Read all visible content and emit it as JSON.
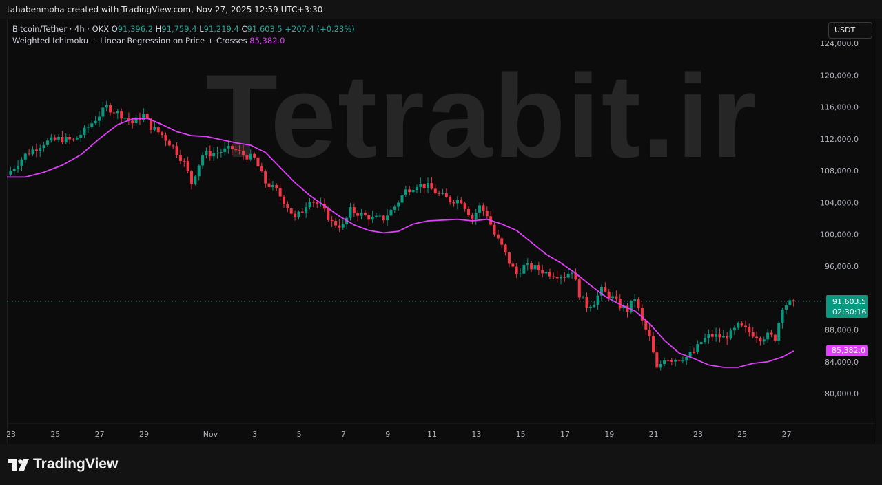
{
  "header": {
    "credit": "tahabenmoha created with TradingView.com, Nov 27, 2025 12:59 UTC+3:30"
  },
  "legend": {
    "symbol": "Bitcoin/Tether · 4h · OKX",
    "o_label": "O",
    "o_value": "91,396.2",
    "h_label": "H",
    "h_value": "91,759.4",
    "l_label": "L",
    "l_value": "91,219.4",
    "c_label": "C",
    "c_value": "91,603.5",
    "change": "+207.4 (+0.23%)",
    "indicator_name": "Weighted Ichimoku + Linear Regression on Price + Crosses",
    "indicator_value": "85,382.0"
  },
  "currency_button": "USDT",
  "watermark": "Tetrabit.ir",
  "price_tag": {
    "price": "91,603.5",
    "countdown": "02:30:16"
  },
  "ma_tag": "85,382.0",
  "footer": {
    "brand": "TradingView"
  },
  "colors": {
    "up": "#089981",
    "down": "#f23645",
    "ma": "#e040fb",
    "background": "#0c0c0c"
  },
  "chart_data": {
    "type": "candlestick",
    "interval": "4h",
    "ylim": [
      78000,
      126000
    ],
    "y_ticks": [
      80000,
      84000,
      88000,
      92000,
      96000,
      100000,
      104000,
      108000,
      112000,
      116000,
      120000,
      124000
    ],
    "y_tick_labels": [
      "80,000.0",
      "84,000.0",
      "88,000.0",
      "",
      "96,000.0",
      "100,000.0",
      "104,000.0",
      "108,000.0",
      "112,000.0",
      "116,000.0",
      "120,000.0",
      "124,000.0"
    ],
    "x_ticks": [
      {
        "label": "23",
        "slot": 0
      },
      {
        "label": "25",
        "slot": 12
      },
      {
        "label": "27",
        "slot": 24
      },
      {
        "label": "29",
        "slot": 36
      },
      {
        "label": "Nov",
        "slot": 54
      },
      {
        "label": "3",
        "slot": 66
      },
      {
        "label": "5",
        "slot": 78
      },
      {
        "label": "7",
        "slot": 90
      },
      {
        "label": "9",
        "slot": 102
      },
      {
        "label": "11",
        "slot": 114
      },
      {
        "label": "13",
        "slot": 126
      },
      {
        "label": "15",
        "slot": 138
      },
      {
        "label": "17",
        "slot": 150
      },
      {
        "label": "19",
        "slot": 162
      },
      {
        "label": "21",
        "slot": 174
      },
      {
        "label": "23",
        "slot": 186
      },
      {
        "label": "25",
        "slot": 198
      },
      {
        "label": "27",
        "slot": 210
      }
    ],
    "close_path": [
      [
        0,
        107500
      ],
      [
        5,
        110000
      ],
      [
        10,
        111500
      ],
      [
        14,
        112000
      ],
      [
        18,
        111800
      ],
      [
        21,
        113000
      ],
      [
        24,
        114500
      ],
      [
        27,
        116000
      ],
      [
        31,
        115000
      ],
      [
        34,
        114000
      ],
      [
        37,
        115000
      ],
      [
        39,
        113500
      ],
      [
        42,
        112500
      ],
      [
        45,
        111000
      ],
      [
        48,
        109000
      ],
      [
        50,
        106500
      ],
      [
        53,
        110000
      ],
      [
        57,
        110300
      ],
      [
        61,
        110800
      ],
      [
        64,
        110000
      ],
      [
        67,
        109500
      ],
      [
        70,
        106500
      ],
      [
        73,
        105500
      ],
      [
        76,
        103500
      ],
      [
        78,
        102000
      ],
      [
        80,
        103000
      ],
      [
        82,
        104500
      ],
      [
        85,
        103500
      ],
      [
        88,
        101500
      ],
      [
        91,
        101000
      ],
      [
        93,
        103000
      ],
      [
        96,
        102500
      ],
      [
        99,
        102000
      ],
      [
        102,
        102000
      ],
      [
        105,
        103500
      ],
      [
        108,
        105500
      ],
      [
        111,
        106300
      ],
      [
        114,
        106000
      ],
      [
        117,
        105000
      ],
      [
        120,
        104300
      ],
      [
        123,
        104300
      ],
      [
        124,
        103500
      ],
      [
        126,
        102000
      ],
      [
        128,
        103500
      ],
      [
        130,
        102500
      ],
      [
        132,
        100000
      ],
      [
        134,
        98500
      ],
      [
        136,
        96500
      ],
      [
        138,
        95000
      ],
      [
        140,
        96000
      ],
      [
        143,
        95800
      ],
      [
        146,
        95200
      ],
      [
        148,
        95000
      ],
      [
        151,
        94800
      ],
      [
        153,
        95500
      ],
      [
        155,
        92500
      ],
      [
        157,
        91000
      ],
      [
        159,
        91500
      ],
      [
        161,
        93000
      ],
      [
        164,
        92000
      ],
      [
        166,
        91000
      ],
      [
        168,
        90500
      ],
      [
        170,
        92000
      ],
      [
        172,
        89000
      ],
      [
        174,
        87000
      ],
      [
        176,
        83000
      ],
      [
        178,
        84500
      ],
      [
        180,
        84300
      ],
      [
        182,
        84400
      ],
      [
        184,
        84600
      ],
      [
        186,
        85200
      ],
      [
        188,
        86500
      ],
      [
        190,
        87200
      ],
      [
        192,
        87300
      ],
      [
        194,
        87000
      ],
      [
        196,
        87500
      ],
      [
        198,
        88500
      ],
      [
        200,
        88000
      ],
      [
        202,
        87500
      ],
      [
        204,
        87000
      ],
      [
        206,
        87300
      ],
      [
        208,
        87000
      ],
      [
        210,
        91000
      ],
      [
        212,
        91400
      ],
      [
        213,
        91603.5
      ]
    ],
    "ma_path": [
      [
        0,
        107200
      ],
      [
        5,
        107200
      ],
      [
        10,
        107800
      ],
      [
        15,
        108700
      ],
      [
        20,
        110000
      ],
      [
        25,
        112000
      ],
      [
        30,
        113800
      ],
      [
        34,
        114500
      ],
      [
        38,
        114600
      ],
      [
        42,
        113800
      ],
      [
        46,
        112900
      ],
      [
        50,
        112400
      ],
      [
        54,
        112300
      ],
      [
        58,
        111900
      ],
      [
        62,
        111500
      ],
      [
        66,
        111200
      ],
      [
        70,
        110300
      ],
      [
        74,
        108400
      ],
      [
        78,
        106500
      ],
      [
        82,
        104900
      ],
      [
        86,
        103600
      ],
      [
        90,
        102300
      ],
      [
        94,
        101200
      ],
      [
        98,
        100500
      ],
      [
        102,
        100200
      ],
      [
        106,
        100400
      ],
      [
        110,
        101300
      ],
      [
        114,
        101700
      ],
      [
        118,
        101800
      ],
      [
        122,
        101900
      ],
      [
        126,
        101700
      ],
      [
        130,
        101900
      ],
      [
        134,
        101300
      ],
      [
        138,
        100500
      ],
      [
        142,
        99000
      ],
      [
        146,
        97500
      ],
      [
        150,
        96400
      ],
      [
        154,
        95100
      ],
      [
        158,
        93600
      ],
      [
        162,
        92200
      ],
      [
        166,
        91200
      ],
      [
        170,
        90400
      ],
      [
        174,
        88800
      ],
      [
        178,
        86700
      ],
      [
        182,
        85100
      ],
      [
        186,
        84400
      ],
      [
        190,
        83600
      ],
      [
        194,
        83300
      ],
      [
        198,
        83300
      ],
      [
        202,
        83800
      ],
      [
        206,
        84000
      ],
      [
        210,
        84600
      ],
      [
        212,
        85100
      ],
      [
        213,
        85382
      ]
    ],
    "last_price": 91603.5,
    "indicator_last": 85382.0,
    "grid": false
  }
}
